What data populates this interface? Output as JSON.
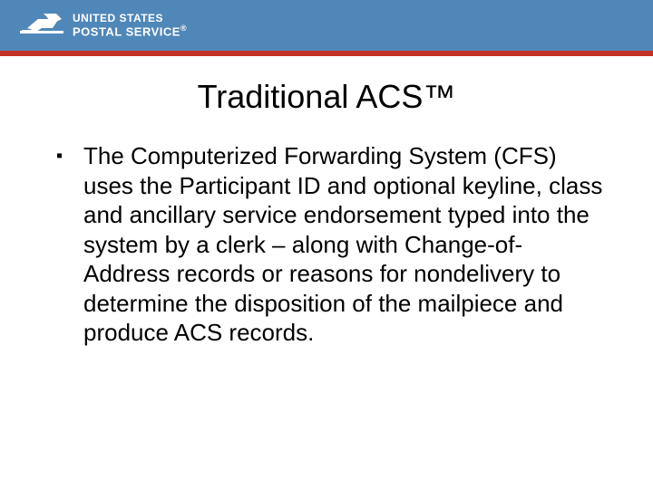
{
  "header": {
    "logo_line1": "UNITED STATES",
    "logo_line2": "POSTAL SERVICE",
    "registered": "®",
    "brand_blue": "#4f87b8",
    "brand_red": "#c33125"
  },
  "slide": {
    "title": "Traditional ACS™",
    "bullets": [
      "The Computerized Forwarding System (CFS) uses the Participant ID and optional keyline, class and ancillary service endorsement typed into the system by a clerk – along with Change-of-Address records or reasons for nondelivery to determine the disposition of the mailpiece and produce ACS records."
    ]
  }
}
